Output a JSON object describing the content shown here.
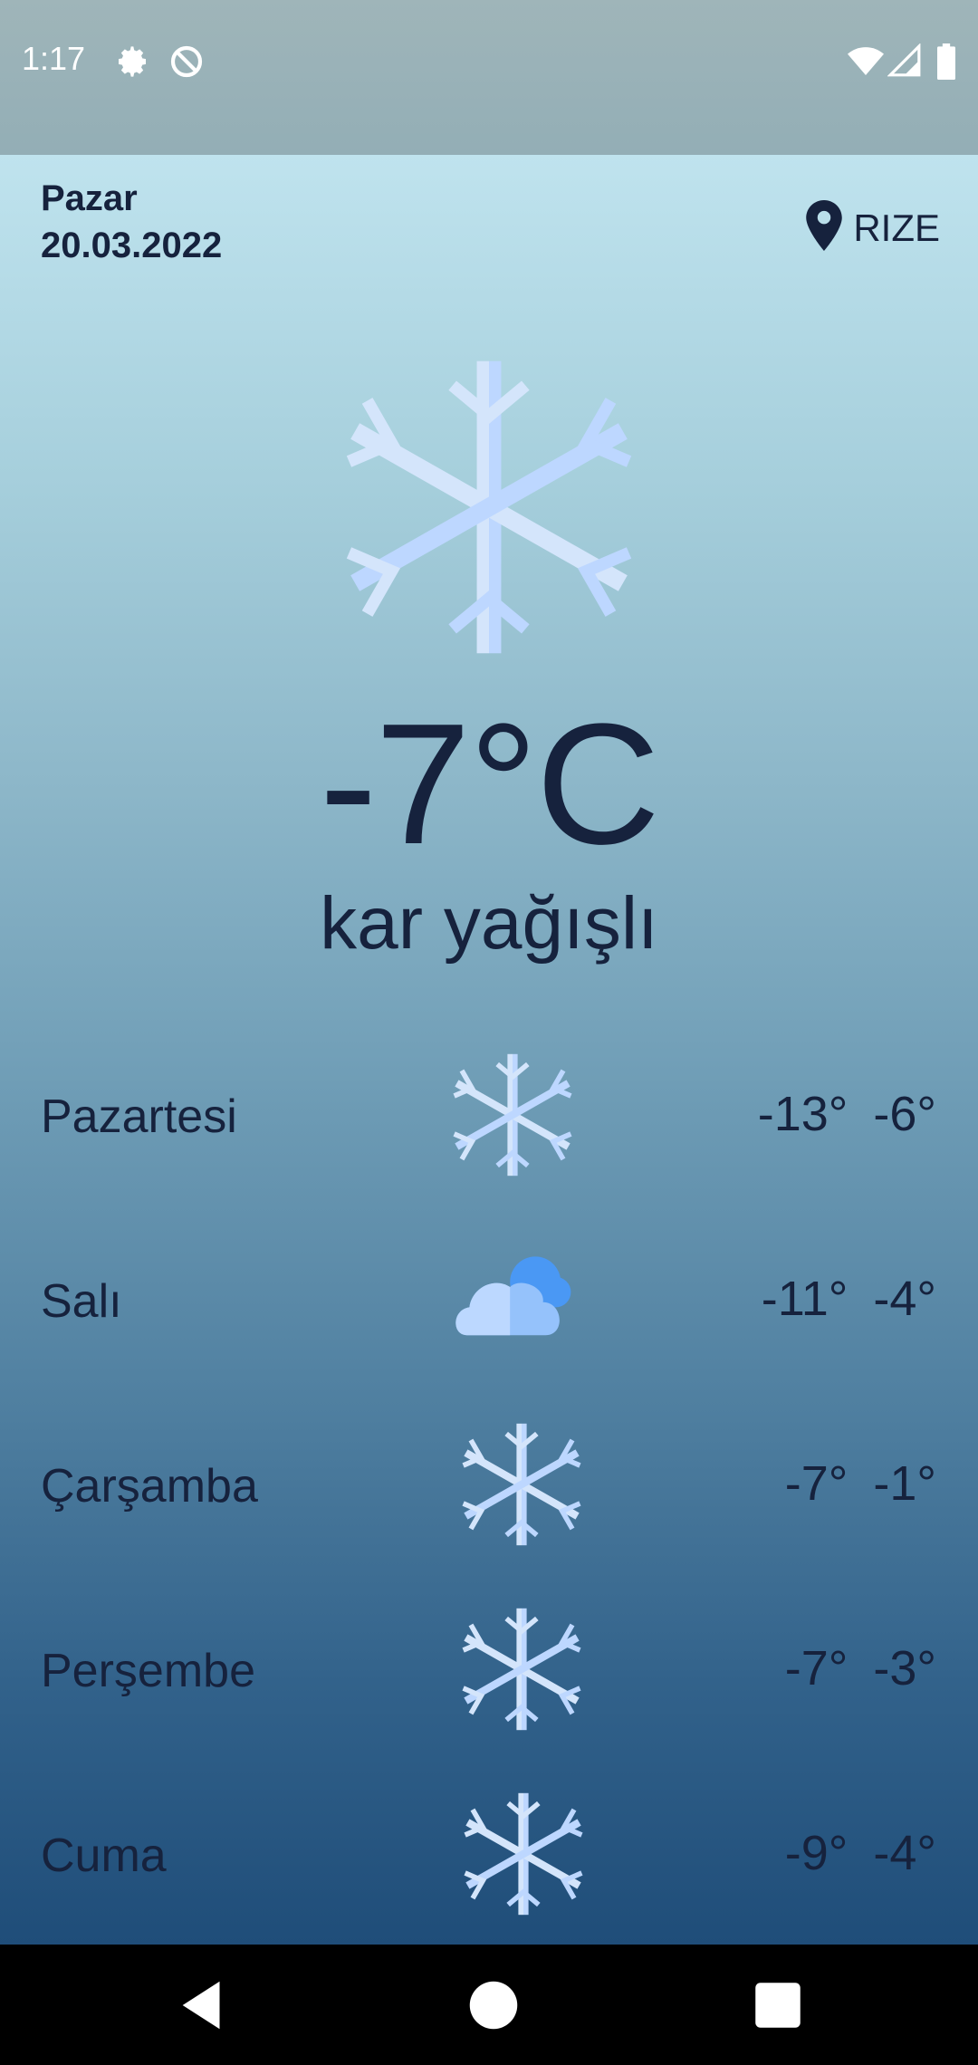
{
  "status_bar": {
    "time": "1:17",
    "icons": [
      "gear-icon",
      "no-entry-icon",
      "wifi-icon",
      "signal-icon",
      "battery-icon"
    ]
  },
  "header": {
    "day": "Pazar",
    "date": "20.03.2022",
    "location": "RIZE",
    "location_icon": "location-pin-icon"
  },
  "current": {
    "icon": "snowflake-icon",
    "temperature": "-7°C",
    "description": "kar yağışlı"
  },
  "forecast": [
    {
      "day": "Pazartesi",
      "icon": "snowflake-icon",
      "low": "-13°",
      "high": "-6°"
    },
    {
      "day": "Salı",
      "icon": "cloud-icon",
      "low": "-11°",
      "high": "-4°"
    },
    {
      "day": "Çarşamba",
      "icon": "snowflake-icon",
      "low": "-7°",
      "high": "-1°"
    },
    {
      "day": "Perşembe",
      "icon": "snowflake-icon",
      "low": "-7°",
      "high": "-3°"
    },
    {
      "day": "Cuma",
      "icon": "snowflake-icon",
      "low": "-9°",
      "high": "-4°"
    }
  ],
  "nav": [
    "back-icon",
    "home-icon",
    "recents-icon"
  ],
  "colors": {
    "snow_light": "#d4e5fb",
    "snow_mid": "#bdd7ff",
    "cloud_light": "#bcd8ff",
    "cloud_mid": "#95c2fb",
    "sun_blue": "#4a98f4",
    "text": "#16223d"
  }
}
